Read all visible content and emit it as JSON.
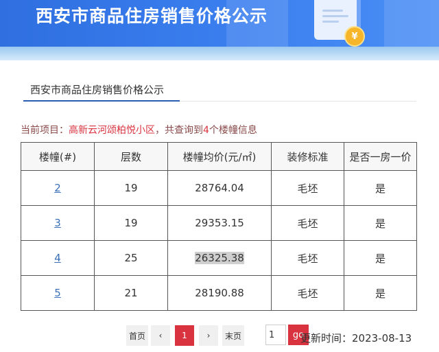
{
  "banner": {
    "title": "西安市商品住房销售价格公示"
  },
  "tab": {
    "label": "西安市商品住房销售价格公示"
  },
  "project": {
    "prefix": "当前项目：",
    "name": "高新云河颂柏悦小区",
    "middle": "，共查询到",
    "count": "4",
    "suffix": "个楼幢信息"
  },
  "table": {
    "headers": [
      "楼幢(#)",
      "层数",
      "楼幢均价(元/㎡)",
      "装修标准",
      "是否一房一价"
    ],
    "rows": [
      {
        "building": "2",
        "floors": "19",
        "price": "28764.04",
        "decoration": "毛坯",
        "one_price": "是"
      },
      {
        "building": "3",
        "floors": "19",
        "price": "29353.15",
        "decoration": "毛坯",
        "one_price": "是"
      },
      {
        "building": "4",
        "floors": "25",
        "price": "26325.38",
        "decoration": "毛坯",
        "one_price": "是"
      },
      {
        "building": "5",
        "floors": "21",
        "price": "28190.88",
        "decoration": "毛坯",
        "one_price": "是"
      }
    ]
  },
  "pagination": {
    "first": "首页",
    "prev": "‹",
    "current": "1",
    "next": "›",
    "last": "末页",
    "input_value": "1",
    "go": "go"
  },
  "update_time": "更新时间：2023-08-13",
  "colors": {
    "banner": "#3b7fef",
    "accent": "#d8333f",
    "link": "#3a6fb8",
    "tab_underline": "#2a5db0"
  },
  "icons": {
    "doc": "document-illustration-icon",
    "coin": "yuan-coin-icon"
  },
  "coin_symbol": "¥"
}
